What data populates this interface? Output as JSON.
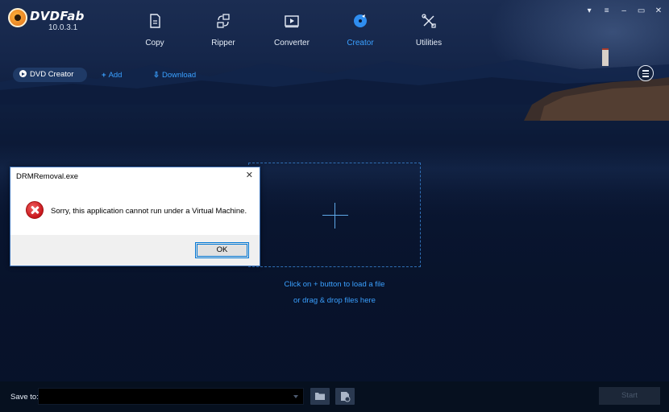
{
  "app": {
    "logo_text": "DVDFab",
    "version": "10.0.3.1"
  },
  "nav": {
    "items": [
      {
        "label": "Copy",
        "icon": "copy-icon",
        "active": false
      },
      {
        "label": "Ripper",
        "icon": "ripper-icon",
        "active": false
      },
      {
        "label": "Converter",
        "icon": "converter-icon",
        "active": false
      },
      {
        "label": "Creator",
        "icon": "creator-disc-icon",
        "active": true
      },
      {
        "label": "Utilities",
        "icon": "utilities-tools-icon",
        "active": false
      }
    ]
  },
  "toolbar": {
    "creator_label": "DVD Creator",
    "add_label": "Add",
    "download_label": "Download"
  },
  "dropzone": {
    "hint_line1": "Click on + button to load a file",
    "hint_line2": "or drag & drop files here"
  },
  "dialog": {
    "title": "DRMRemoval.exe",
    "message": "Sorry, this application cannot run under a Virtual Machine.",
    "ok_label": "OK",
    "close_glyph": "✕"
  },
  "bottom": {
    "save_to_label": "Save to:",
    "save_to_value": "",
    "start_label": "Start"
  },
  "colors": {
    "accent": "#3aa0ff",
    "background": "#0b1a33",
    "error": "#c8161c"
  }
}
